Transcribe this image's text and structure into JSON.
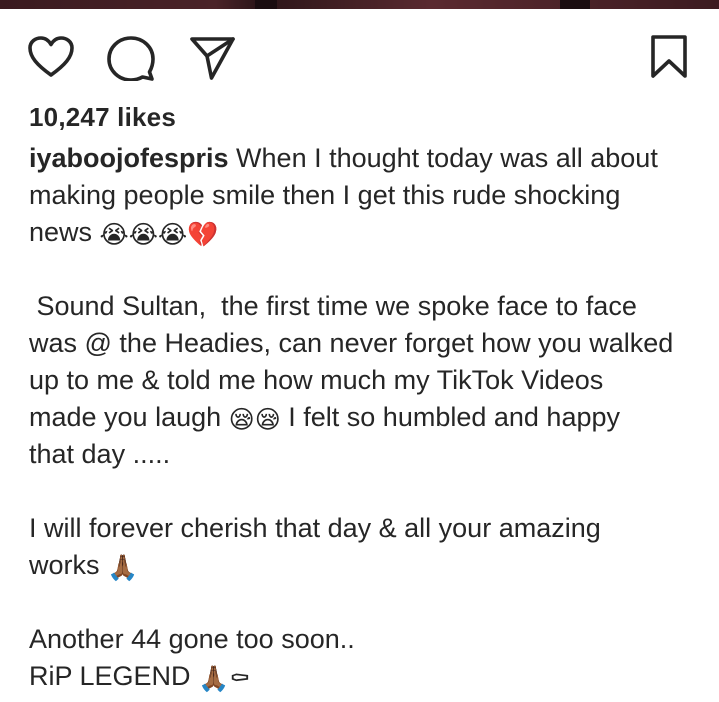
{
  "post": {
    "likes": "10,247 likes",
    "username": "iyaboojofespris",
    "caption": {
      "p1_line1": " When I thought today was all about",
      "p1_line2": "making people smile then I get this rude shocking",
      "p1_line3": "news ",
      "p1_emoji": "😭😭😭💔",
      "p2_line1": " Sound Sultan,  the first time we spoke face to face",
      "p2_line2": "was @ the Headies, can never forget how you walked",
      "p2_line3": "up to me & told me how much my TikTok Videos",
      "p2_line4a": "made you laugh ",
      "p2_emoji": "😪😪",
      "p2_line4b": " I felt so humbled and happy",
      "p2_line5": "that day .....",
      "p3_line1": "I will forever cherish that day & all your amazing",
      "p3_line2": "works ",
      "p3_emoji": "🙏🏾",
      "p4_line1": "Another 44 gone too soon..",
      "p4_line2": "RiP LEGEND ",
      "p4_emoji": "🙏🏾⚰"
    }
  },
  "icons": {
    "like": "heart-icon",
    "comment": "comment-icon",
    "share": "send-icon",
    "save": "bookmark-icon"
  },
  "colors": {
    "text": "#262626",
    "background": "#ffffff"
  }
}
